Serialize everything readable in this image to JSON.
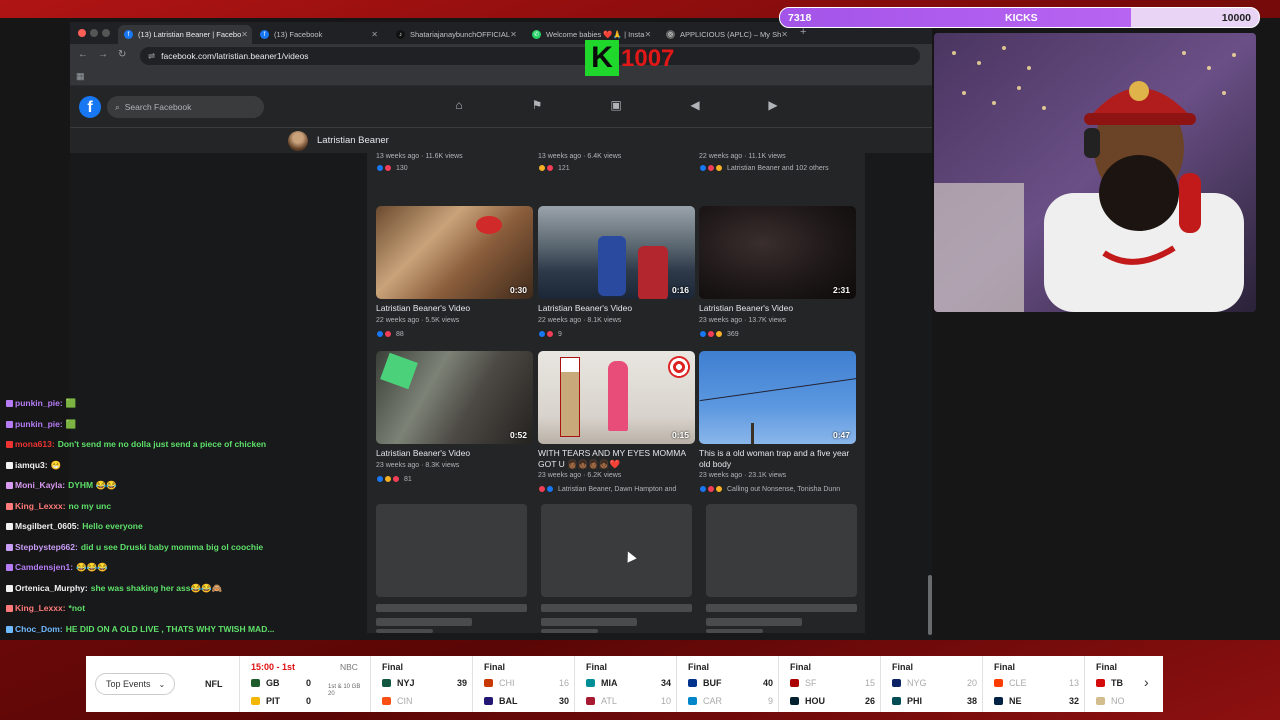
{
  "stream": {
    "kicks": {
      "current": "7318",
      "label": "KICKS",
      "goal": "10000",
      "progress": 0.7318
    },
    "station_logo": {
      "letter": "K",
      "number": "1007"
    }
  },
  "browser": {
    "tabs": [
      {
        "label": "(13) Latristian Beaner | Facebo",
        "icon": "facebook-icon",
        "active": true
      },
      {
        "label": "(13) Facebook",
        "icon": "facebook-icon",
        "active": false
      },
      {
        "label": "ShatariajanaybunchOFFICIAL",
        "icon": "tiktok-icon",
        "active": false
      },
      {
        "label": "Welcome babies ❤️🙏 | Insta",
        "icon": "whatsapp-icon",
        "active": false
      },
      {
        "label": "APPLICIOUS (APLC) – My Sh",
        "icon": "globe-icon",
        "active": false
      }
    ],
    "url": "facebook.com/latristian.beaner1/videos"
  },
  "facebook": {
    "search_placeholder": "Search Facebook",
    "profile_name": "Latristian Beaner",
    "top_row": [
      {
        "meta": "13 weeks ago · 11.6K views",
        "reactions": "130"
      },
      {
        "meta": "13 weeks ago · 6.4K views",
        "reactions": "121"
      },
      {
        "meta": "22 weeks ago · 11.1K views",
        "reactions": "Latristian Beaner and 102 others"
      }
    ],
    "videos": [
      {
        "title": "Latristian Beaner's Video",
        "duration": "0:30",
        "meta": "22 weeks ago · 5.5K views",
        "reactions": "88"
      },
      {
        "title": "Latristian Beaner's Video",
        "duration": "0:16",
        "meta": "22 weeks ago · 8.1K views",
        "reactions": "9"
      },
      {
        "title": "Latristian Beaner's Video",
        "duration": "2:31",
        "meta": "23 weeks ago · 13.7K views",
        "reactions": "369"
      },
      {
        "title": "Latristian Beaner's Video",
        "duration": "0:52",
        "meta": "23 weeks ago · 8.3K views",
        "reactions": "81"
      },
      {
        "title": "WITH TEARS AND MY EYES MOMMA GOT U 👩🏾‍👧🏾👩🏾‍👧🏾❤️",
        "duration": "0:15",
        "meta": "23 weeks ago · 6.2K views",
        "reactions": "Latristian Beaner, Dawn Hampton and"
      },
      {
        "title": "This is a old woman trap and a five year old body",
        "duration": "0:47",
        "meta": "23 weeks ago · 23.1K views",
        "reactions": "Calling out Nonsense, Tonisha Dunn"
      }
    ]
  },
  "chat": [
    {
      "user": "punkin_pie:",
      "text": "🟩",
      "color": "#b57cf6"
    },
    {
      "user": "punkin_pie:",
      "text": "🟩",
      "color": "#b57cf6"
    },
    {
      "user": "mona613:",
      "text": "Don't send me no dolla just send a piece of chicken",
      "color": "#e33"
    },
    {
      "user": "iamqu3:",
      "text": "😁",
      "color": "#f2f2f2"
    },
    {
      "user": "Moni_Kayla:",
      "text": "DYHM 😂😂",
      "color": "#d99af2"
    },
    {
      "user": "King_Lexxx:",
      "text": "no my unc",
      "color": "#ff7a7a"
    },
    {
      "user": "Msgilbert_0605:",
      "text": "Hello everyone",
      "color": "#f2f2f2"
    },
    {
      "user": "Stepbystep662:",
      "text": "did u see Druski baby momma big ol coochie",
      "color": "#c89df5"
    },
    {
      "user": "Camdensjen1:",
      "text": "😂😂😂",
      "color": "#b57cf6"
    },
    {
      "user": "Ortenica_Murphy:",
      "text": "she was shaking her ass😂😂🙈",
      "color": "#f2f2f2"
    },
    {
      "user": "King_Lexxx:",
      "text": "*not",
      "color": "#ff7a7a"
    },
    {
      "user": "Choc_Dom:",
      "text": "HE DID ON A OLD LIVE , THATS WHY TWISH MAD...",
      "color": "#6fb9ff"
    }
  ],
  "ticker": {
    "filter_label": "Top Events",
    "league": "NFL",
    "games": [
      {
        "status": "15:00 - 1st",
        "network": "NBC",
        "extra": "1st & 10 GB 20",
        "home": {
          "name": "GB",
          "score": "0",
          "color": "#1e5c2c"
        },
        "away": {
          "name": "PIT",
          "score": "0",
          "color": "#f2b705"
        },
        "live": true
      },
      {
        "status": "Final",
        "network": "",
        "extra": "",
        "home": {
          "name": "NYJ",
          "score": "39",
          "color": "#125740",
          "win": true
        },
        "away": {
          "name": "CIN",
          "score": "",
          "color": "#fb4f14",
          "win": false
        }
      },
      {
        "status": "Final",
        "network": "",
        "extra": "",
        "home": {
          "name": "CHI",
          "score": "16",
          "color": "#c83803",
          "win": false
        },
        "away": {
          "name": "BAL",
          "score": "30",
          "color": "#241773",
          "win": true
        }
      },
      {
        "status": "Final",
        "network": "",
        "extra": "",
        "home": {
          "name": "MIA",
          "score": "34",
          "color": "#008e97",
          "win": true
        },
        "away": {
          "name": "ATL",
          "score": "10",
          "color": "#a71930",
          "win": false
        }
      },
      {
        "status": "Final",
        "network": "",
        "extra": "",
        "home": {
          "name": "BUF",
          "score": "40",
          "color": "#00338d",
          "win": true
        },
        "away": {
          "name": "CAR",
          "score": "9",
          "color": "#0085ca",
          "win": false
        }
      },
      {
        "status": "Final",
        "network": "",
        "extra": "",
        "home": {
          "name": "SF",
          "score": "15",
          "color": "#aa0000",
          "win": false
        },
        "away": {
          "name": "HOU",
          "score": "26",
          "color": "#03202f",
          "win": true
        }
      },
      {
        "status": "Final",
        "network": "",
        "extra": "",
        "home": {
          "name": "NYG",
          "score": "20",
          "color": "#0b2265",
          "win": false
        },
        "away": {
          "name": "PHI",
          "score": "38",
          "color": "#004c54",
          "win": true
        }
      },
      {
        "status": "Final",
        "network": "",
        "extra": "",
        "home": {
          "name": "CLE",
          "score": "13",
          "color": "#ff3c00",
          "win": false
        },
        "away": {
          "name": "NE",
          "score": "32",
          "color": "#002244",
          "win": true
        }
      },
      {
        "status": "Final",
        "network": "",
        "extra": "",
        "home": {
          "name": "TB",
          "score": "",
          "color": "#d50a0a",
          "win": true
        },
        "away": {
          "name": "NO",
          "score": "",
          "color": "#d3bc8d",
          "win": false
        }
      }
    ]
  }
}
